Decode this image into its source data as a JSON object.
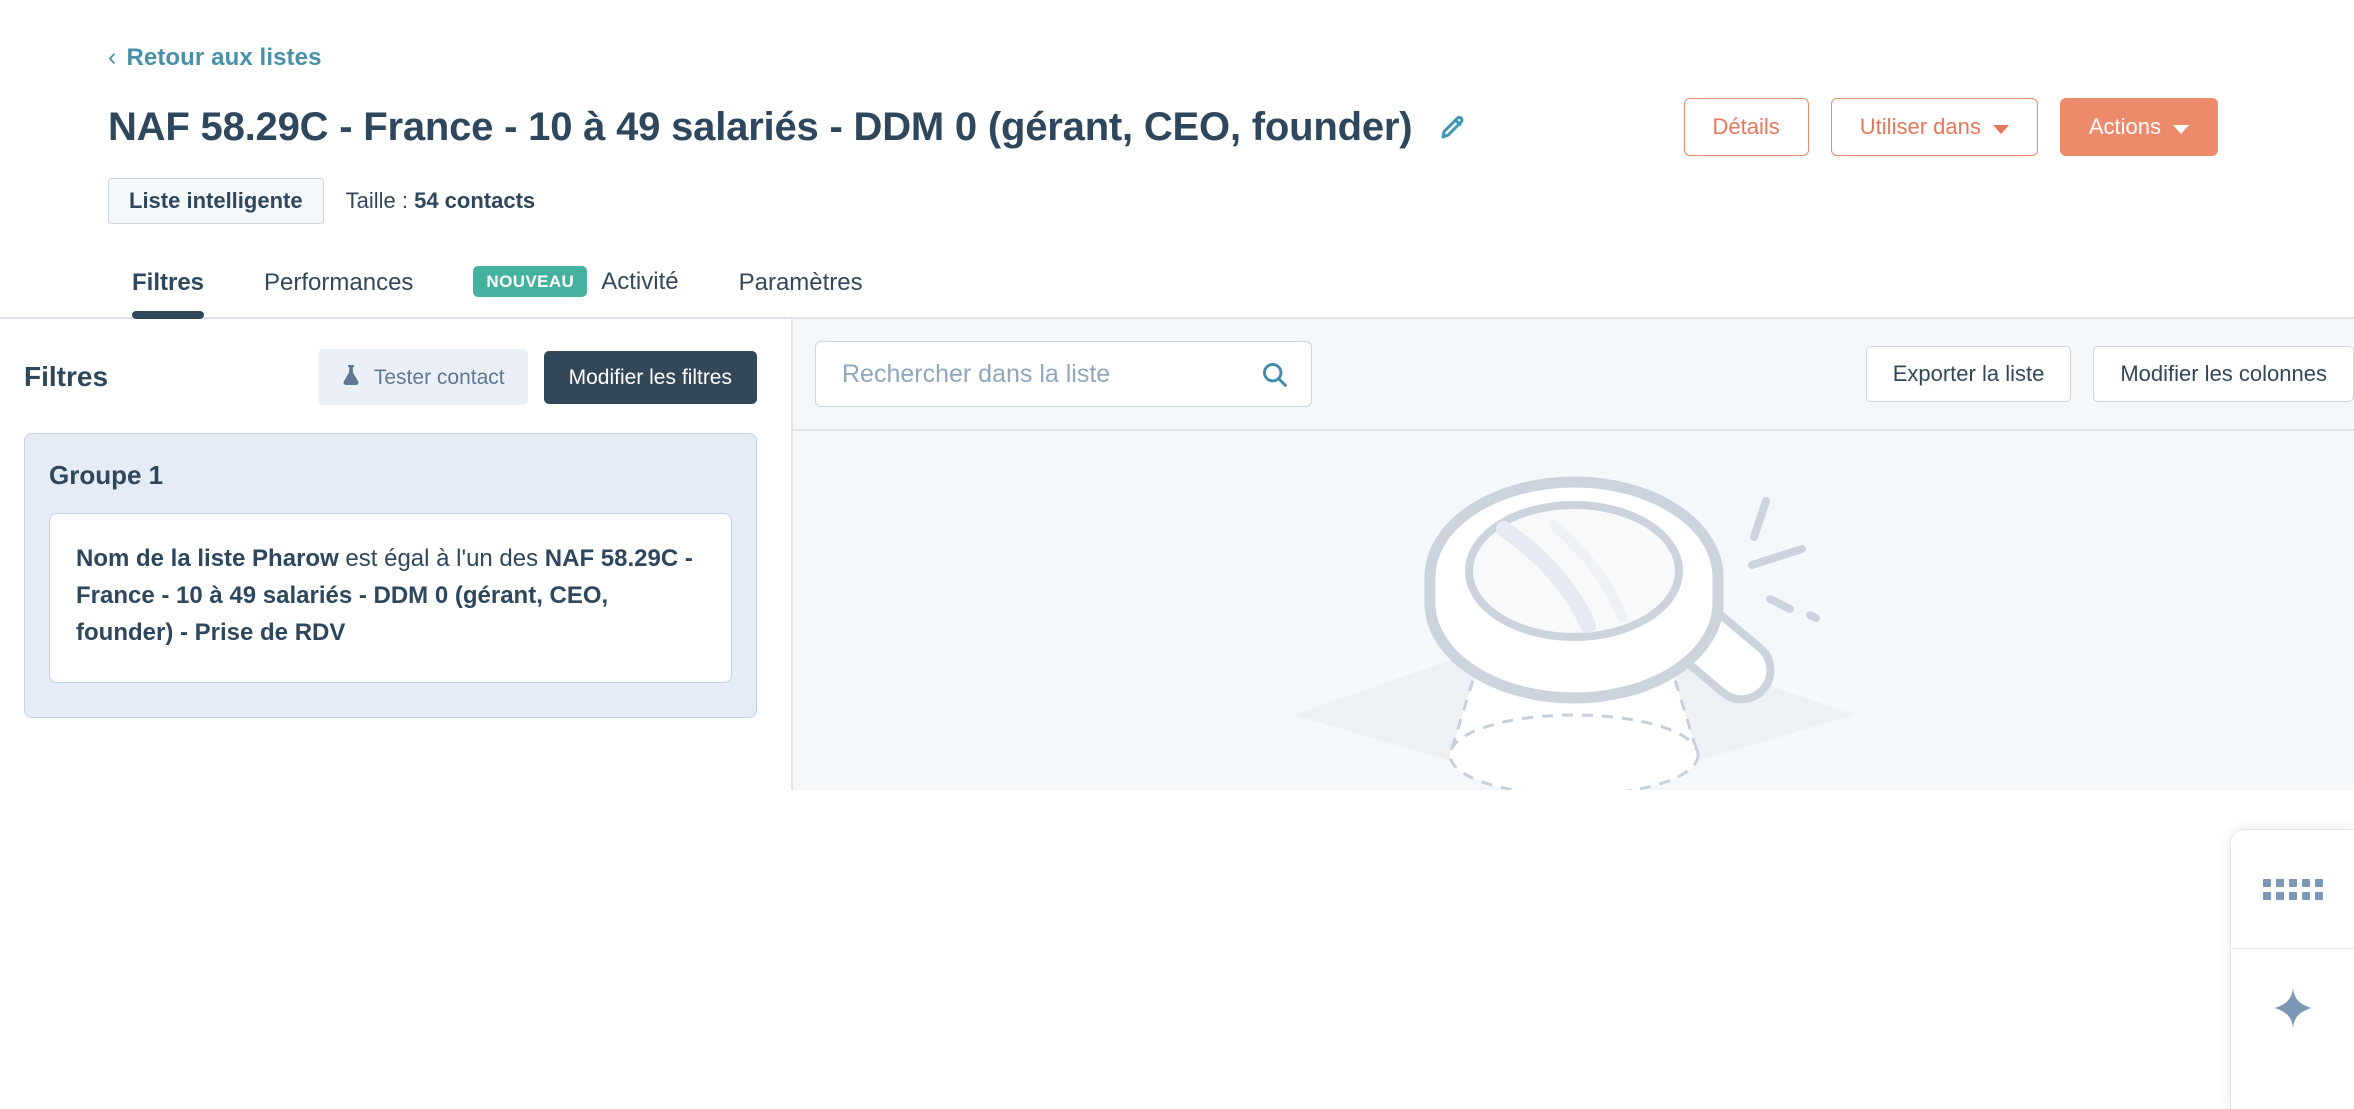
{
  "header": {
    "back_link": "Retour aux listes",
    "back_icon": "chevron-left-icon",
    "title": "NAF 58.29C - France - 10 à 49 salariés - DDM 0 (gérant, CEO, founder)",
    "edit_icon": "pencil-icon",
    "actions": [
      {
        "label": "Détails",
        "style": "secondary",
        "caret": false
      },
      {
        "label": "Utiliser dans",
        "style": "secondary",
        "caret": true
      },
      {
        "label": "Actions",
        "style": "primary",
        "caret": true
      }
    ],
    "list_type_chip": "Liste intelligente",
    "size_label": "Taille :",
    "size_value": "54 contacts"
  },
  "tabs": [
    {
      "label": "Filtres",
      "active": true,
      "badge": null
    },
    {
      "label": "Performances",
      "active": false,
      "badge": null
    },
    {
      "label": "Activité",
      "active": false,
      "badge": "NOUVEAU"
    },
    {
      "label": "Paramètres",
      "active": false,
      "badge": null
    }
  ],
  "filters_pane": {
    "heading": "Filtres",
    "test_contact_button": "Tester contact",
    "test_contact_icon": "flask-icon",
    "edit_filters_button": "Modifier les filtres",
    "group": {
      "title": "Groupe 1",
      "criterion": {
        "property": "Nom de la liste Pharow",
        "operator": "est égal à l'un des",
        "value": "NAF 58.29C - France - 10 à 49 salariés - DDM 0 (gérant, CEO, founder) - Prise de RDV"
      }
    }
  },
  "content": {
    "search_placeholder": "Rechercher dans la liste",
    "search_value": "",
    "search_icon": "search-icon",
    "export_button": "Exporter la liste",
    "edit_columns_button": "Modifier les colonnes",
    "empty_state_icon": "magnifying-glass-illustration"
  },
  "rail": {
    "items": [
      {
        "name": "apps-grid-icon"
      },
      {
        "name": "sparkle-ai-icon"
      }
    ]
  },
  "colors": {
    "navy": "#33475b",
    "navy_dark": "#2e475d",
    "link": "#4a90a8",
    "orange": "#ec8a6b",
    "teal": "#45b2a0",
    "panel_bg": "#f5f8fa",
    "group_bg": "#e5ecf5",
    "border": "#cbd6e2"
  }
}
